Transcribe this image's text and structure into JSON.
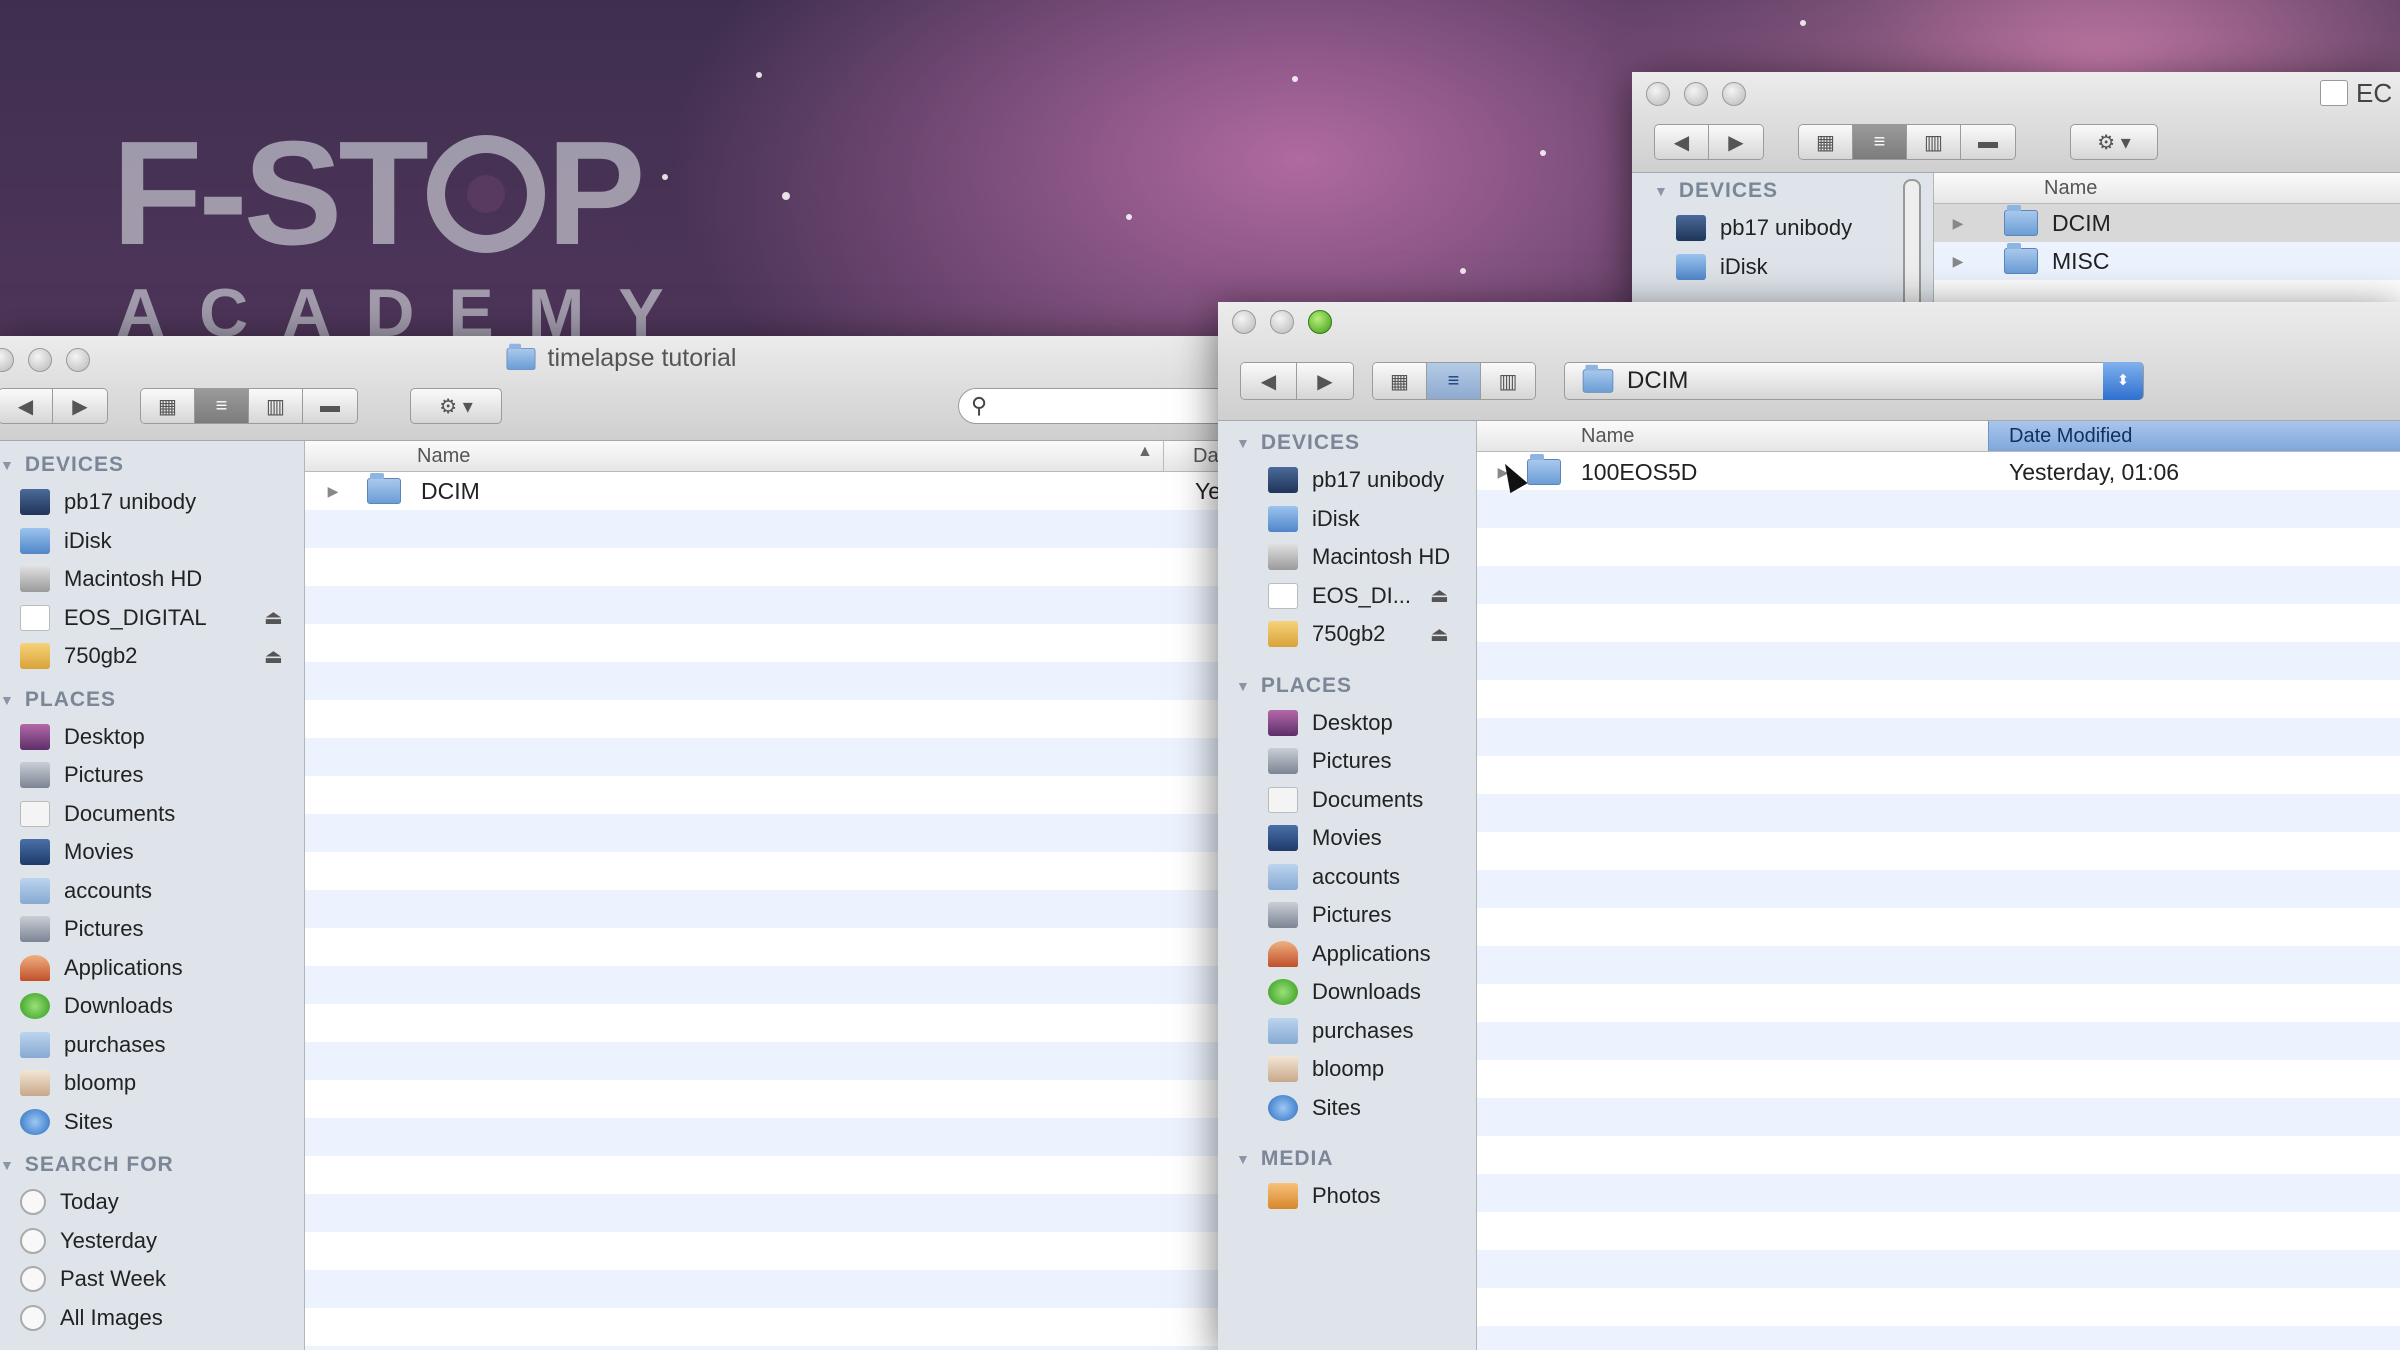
{
  "logo": {
    "line1_left": "F-ST",
    "line1_right": "P",
    "line2": "ACADEMY"
  },
  "window_back": {
    "title_fragment": "EC",
    "devices_header": "DEVICES",
    "devices": [
      {
        "label": "pb17 unibody",
        "icon": "laptop-icon"
      },
      {
        "label": "iDisk",
        "icon": "idisk-icon"
      }
    ],
    "column_name": "Name",
    "rows": [
      {
        "name": "DCIM"
      },
      {
        "name": "MISC"
      }
    ]
  },
  "window_left": {
    "title": "timelapse tutorial",
    "devices_header": "DEVICES",
    "devices": [
      {
        "label": "pb17 unibody",
        "icon": "laptop-icon",
        "eject": false
      },
      {
        "label": "iDisk",
        "icon": "idisk-icon",
        "eject": false
      },
      {
        "label": "Macintosh HD",
        "icon": "hard-drive-icon",
        "eject": false
      },
      {
        "label": "EOS_DIGITAL",
        "icon": "sd-card-icon",
        "eject": true
      },
      {
        "label": "750gb2",
        "icon": "external-drive-icon",
        "eject": true
      }
    ],
    "places_header": "PLACES",
    "places": [
      {
        "label": "Desktop",
        "icon": "desktop-icon"
      },
      {
        "label": "Pictures",
        "icon": "pictures-icon"
      },
      {
        "label": "Documents",
        "icon": "documents-icon"
      },
      {
        "label": "Movies",
        "icon": "movies-icon"
      },
      {
        "label": "accounts",
        "icon": "folder-icon"
      },
      {
        "label": "Pictures",
        "icon": "pictures-icon"
      },
      {
        "label": "Applications",
        "icon": "applications-icon"
      },
      {
        "label": "Downloads",
        "icon": "downloads-icon"
      },
      {
        "label": "purchases",
        "icon": "folder-icon"
      },
      {
        "label": "bloomp",
        "icon": "home-icon"
      },
      {
        "label": "Sites",
        "icon": "sites-icon"
      }
    ],
    "search_header": "SEARCH FOR",
    "search_items": [
      {
        "label": "Today",
        "icon": "clock-icon"
      },
      {
        "label": "Yesterday",
        "icon": "clock-icon"
      },
      {
        "label": "Past Week",
        "icon": "clock-icon"
      },
      {
        "label": "All Images",
        "icon": "clock-icon"
      }
    ],
    "column_name": "Name",
    "column_date_fragment": "Da",
    "rows": [
      {
        "name": "DCIM",
        "date_fragment": "Ye"
      }
    ]
  },
  "window_front": {
    "path_popup": "DCIM",
    "devices_header": "DEVICES",
    "devices": [
      {
        "label": "pb17 unibody",
        "icon": "laptop-icon",
        "eject": false
      },
      {
        "label": "iDisk",
        "icon": "idisk-icon",
        "eject": false
      },
      {
        "label": "Macintosh HD",
        "icon": "hard-drive-icon",
        "eject": false
      },
      {
        "label": "EOS_DI...",
        "icon": "sd-card-icon",
        "eject": true
      },
      {
        "label": "750gb2",
        "icon": "external-drive-icon",
        "eject": true
      }
    ],
    "places_header": "PLACES",
    "places": [
      {
        "label": "Desktop",
        "icon": "desktop-icon"
      },
      {
        "label": "Pictures",
        "icon": "pictures-icon"
      },
      {
        "label": "Documents",
        "icon": "documents-icon"
      },
      {
        "label": "Movies",
        "icon": "movies-icon"
      },
      {
        "label": "accounts",
        "icon": "folder-icon"
      },
      {
        "label": "Pictures",
        "icon": "pictures-icon"
      },
      {
        "label": "Applications",
        "icon": "applications-icon"
      },
      {
        "label": "Downloads",
        "icon": "downloads-icon"
      },
      {
        "label": "purchases",
        "icon": "folder-icon"
      },
      {
        "label": "bloomp",
        "icon": "home-icon"
      },
      {
        "label": "Sites",
        "icon": "sites-icon"
      }
    ],
    "media_header": "MEDIA",
    "media": [
      {
        "label": "Photos",
        "icon": "photos-icon"
      }
    ],
    "column_name": "Name",
    "column_date": "Date Modified",
    "rows": [
      {
        "name": "100EOS5D",
        "date": "Yesterday, 01:06"
      }
    ]
  },
  "colors": {
    "selected_header": "#7fa7dc",
    "sidebar_bg": "#dee4ea",
    "row_stripe": "#edf3fe"
  }
}
